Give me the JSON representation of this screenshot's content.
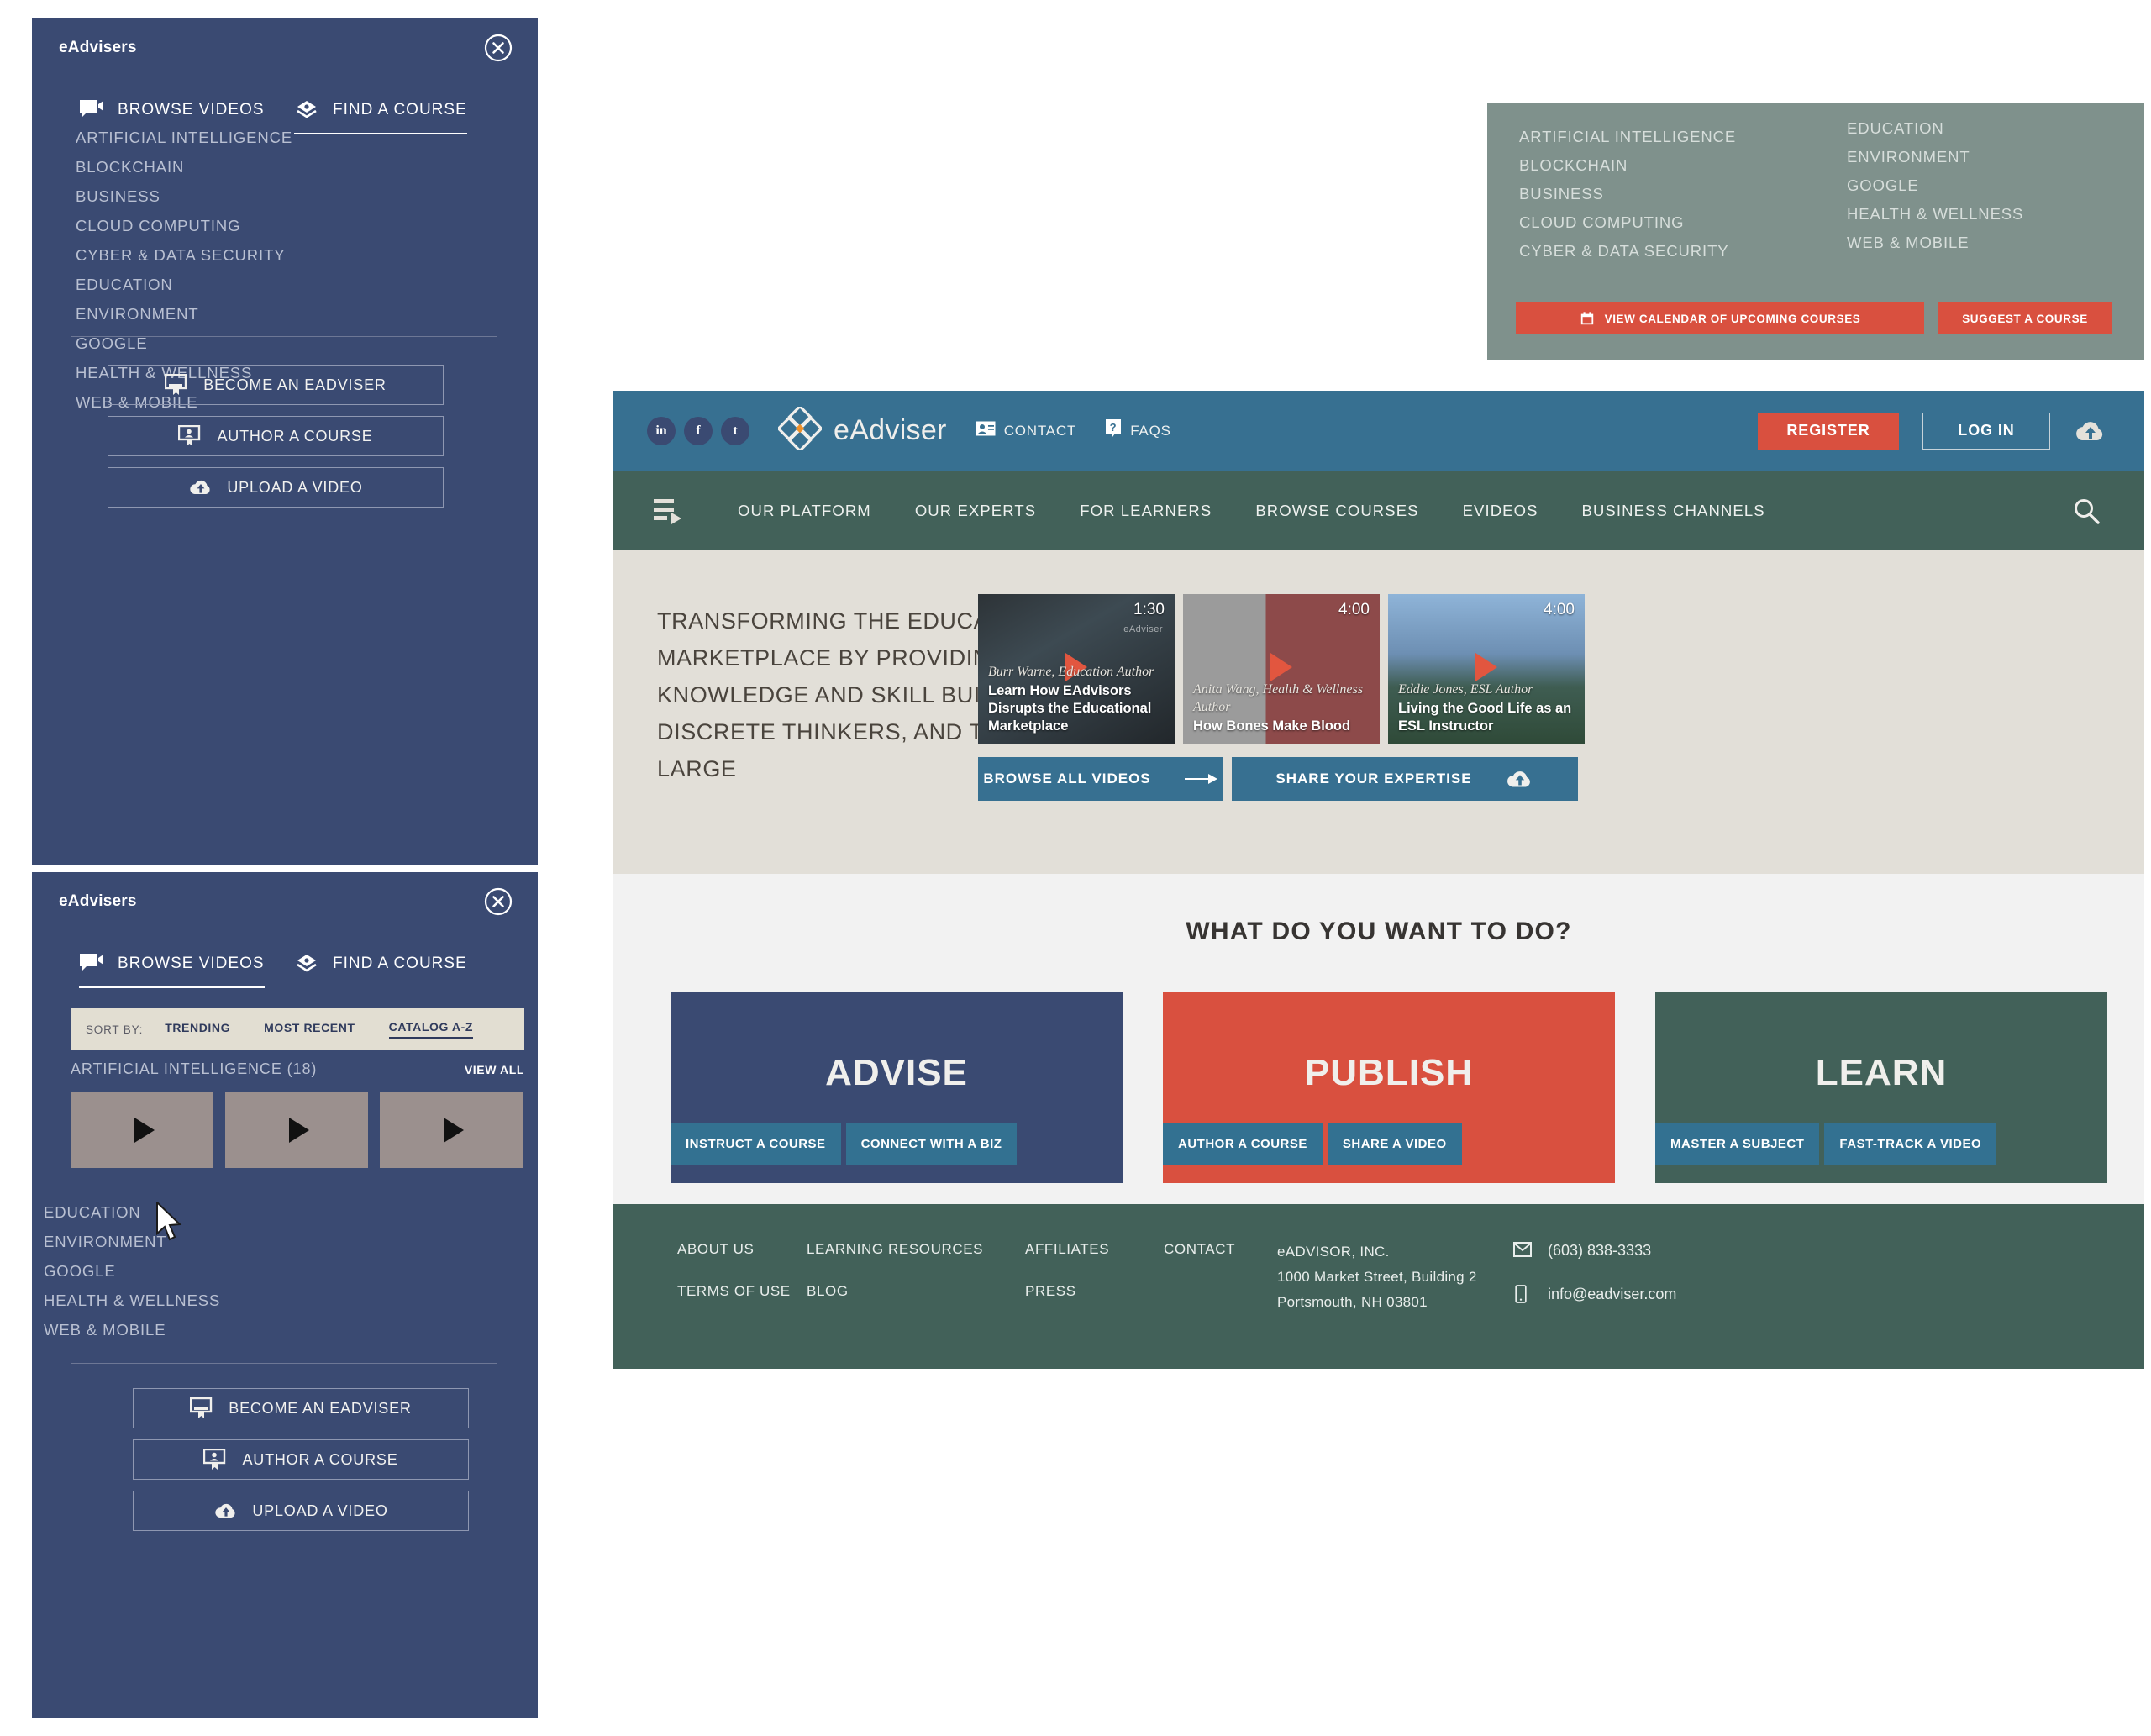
{
  "menu_courses": {
    "title": "eAdvisers",
    "close_icon": "close-circle-icon",
    "tabs": [
      {
        "label": "BROWSE VIDEOS",
        "icon": "video-chat-icon",
        "active": false
      },
      {
        "label": "FIND A COURSE",
        "icon": "course-layers-icon",
        "active": true
      }
    ],
    "categories": [
      "ARTIFICIAL INTELLIGENCE",
      "BLOCKCHAIN",
      "BUSINESS",
      "CLOUD COMPUTING",
      "CYBER & DATA SECURITY",
      "EDUCATION",
      "ENVIRONMENT",
      "GOOGLE",
      "HEALTH & WELLNESS",
      "WEB & MOBILE"
    ],
    "actions": [
      {
        "label": "BECOME AN EADVISER",
        "icon": "certificate-board-icon"
      },
      {
        "label": "AUTHOR A COURSE",
        "icon": "author-board-icon"
      },
      {
        "label": "UPLOAD A VIDEO",
        "icon": "cloud-upload-icon"
      }
    ]
  },
  "menu_videos": {
    "title": "eAdvisers",
    "close_icon": "close-circle-icon",
    "tabs": [
      {
        "label": "BROWSE VIDEOS",
        "icon": "video-chat-icon",
        "active": true
      },
      {
        "label": "FIND A COURSE",
        "icon": "course-layers-icon",
        "active": false
      }
    ],
    "sort": {
      "label": "SORT BY:",
      "options": [
        "TRENDING",
        "MOST RECENT",
        "CATALOG A-Z"
      ],
      "selected": "CATALOG A-Z"
    },
    "current_category": "ARTIFICIAL INTELLIGENCE (18)",
    "view_all_label": "VIEW ALL",
    "thumbnail_count": 3,
    "categories": [
      "EDUCATION",
      "ENVIRONMENT",
      "GOOGLE",
      "HEALTH & WELLNESS",
      "WEB & MOBILE"
    ],
    "actions": [
      {
        "label": "BECOME AN EADVISER",
        "icon": "certificate-board-icon"
      },
      {
        "label": "AUTHOR A COURSE",
        "icon": "author-board-icon"
      },
      {
        "label": "UPLOAD A VIDEO",
        "icon": "cloud-upload-icon"
      }
    ]
  },
  "course_flyout": {
    "col_left": [
      "ARTIFICIAL INTELLIGENCE",
      "BLOCKCHAIN",
      "BUSINESS",
      "CLOUD COMPUTING",
      "CYBER & DATA SECURITY"
    ],
    "col_right": [
      "EDUCATION",
      "ENVIRONMENT",
      "GOOGLE",
      "HEALTH & WELLNESS",
      "WEB & MOBILE"
    ],
    "calendar_button": "VIEW CALENDAR OF UPCOMING COURSES",
    "calendar_icon": "calendar-icon",
    "suggest_button": "SUGGEST A COURSE"
  },
  "site": {
    "header": {
      "social": [
        {
          "name": "linkedin",
          "glyph": "in"
        },
        {
          "name": "facebook",
          "glyph": "f"
        },
        {
          "name": "tumblr",
          "glyph": "t"
        }
      ],
      "brand": "eAdviser",
      "brand_icon": "diamond-cluster-logo",
      "links": [
        {
          "label": "CONTACT",
          "icon": "contact-card-icon"
        },
        {
          "label": "FAQS",
          "icon": "question-badge-icon"
        }
      ],
      "register_label": "REGISTER",
      "login_label": "LOG IN",
      "upload_icon": "cloud-upload-icon"
    },
    "nav": {
      "burger_icon": "playlist-menu-icon",
      "items": [
        "OUR PLATFORM",
        "OUR EXPERTS",
        "FOR LEARNERS",
        "BROWSE COURSES",
        "EVIDEOS",
        "BUSINESS CHANNELS"
      ],
      "search_icon": "search-icon"
    },
    "hero": {
      "headline": "TRANSFORMING THE EDUCATIONAL MARKETPLACE BY PROVIDING KNOWLEDGE AND SKILL BUILDING FOR DISCRETE THINKERS, AND THE MASSES AT LARGE",
      "videos": [
        {
          "duration": "1:30",
          "author": "Burr Warne, Education Author",
          "title": "Learn How EAdvisors Disrupts the Educational  Marketplace",
          "watermark": "eAdviser"
        },
        {
          "duration": "4:00",
          "author": "Anita Wang, Health & Wellness Author",
          "title": "How Bones Make Blood",
          "watermark": ""
        },
        {
          "duration": "4:00",
          "author": "Eddie Jones, ESL Author",
          "title": "Living the Good Life as an ESL Instructor",
          "watermark": ""
        }
      ],
      "browse_all_label": "BROWSE ALL VIDEOS",
      "browse_all_icon": "arrow-right-icon",
      "share_label": "SHARE YOUR EXPERTISE",
      "share_icon": "cloud-upload-icon"
    },
    "wdywtd": {
      "heading": "WHAT DO YOU WANT TO DO?",
      "choices": [
        {
          "title": "ADVISE",
          "color": "#3a4a72",
          "buttons": [
            "INSTRUCT A COURSE",
            "CONNECT WITH A BIZ"
          ]
        },
        {
          "title": "PUBLISH",
          "color": "#d9503f",
          "buttons": [
            "AUTHOR A COURSE",
            "SHARE A VIDEO"
          ]
        },
        {
          "title": "LEARN",
          "color": "#426159",
          "buttons": [
            "MASTER A SUBJECT",
            "FAST-TRACK A VIDEO"
          ]
        }
      ]
    },
    "footer": {
      "col1": [
        "ABOUT US",
        "TERMS OF USE"
      ],
      "col2": [
        "LEARNING RESOURCES",
        "BLOG"
      ],
      "col3": [
        "AFFILIATES",
        "PRESS"
      ],
      "contact_label": "CONTACT",
      "company": "eADVISOR, INC.",
      "address1": "1000 Market Street, Building 2",
      "address2": "Portsmouth, NH 03801",
      "phone": "(603) 838-3333",
      "phone_icon": "envelope-icon",
      "email": "info@eadviser.com",
      "email_icon": "mobile-phone-icon"
    }
  },
  "colors": {
    "navy": "#3a4a72",
    "header_blue": "#377091",
    "nav_green": "#426159",
    "accent_red": "#d9503f",
    "hero_bg": "#e2dfd8",
    "flyout_grey": "#7f918c",
    "logo_accent": "#f0912a"
  }
}
